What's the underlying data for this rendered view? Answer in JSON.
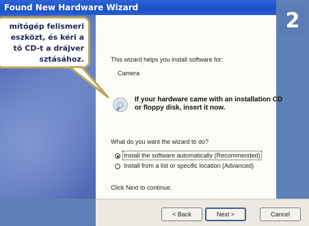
{
  "window": {
    "title": "Found New Hardware Wizard"
  },
  "step_badge": "2",
  "callout": {
    "lines": [
      "mítógép felismeri",
      "eszközt, és kéri a",
      "tő CD-t a drájver",
      "sztásához."
    ]
  },
  "wizard": {
    "intro": "This wizard helps you install software for:",
    "device": "Camera",
    "cd_prompt_line1": "If your hardware came with an installation CD",
    "cd_prompt_line2": "or floppy disk, insert it now.",
    "question": "What do you want the wizard to do?",
    "options": [
      {
        "label": "Install the software automatically (Recommended)",
        "selected": true
      },
      {
        "label": "Install from a list or specific location (Advanced)",
        "selected": false
      }
    ],
    "footer": "Click Next to continue."
  },
  "buttons": {
    "back": "< Back",
    "next": "Next >",
    "cancel": "Cancel"
  },
  "colors": {
    "titlebar": "#1b4fc5",
    "frame": "#5f80b6",
    "callout_border": "#bba65c"
  }
}
